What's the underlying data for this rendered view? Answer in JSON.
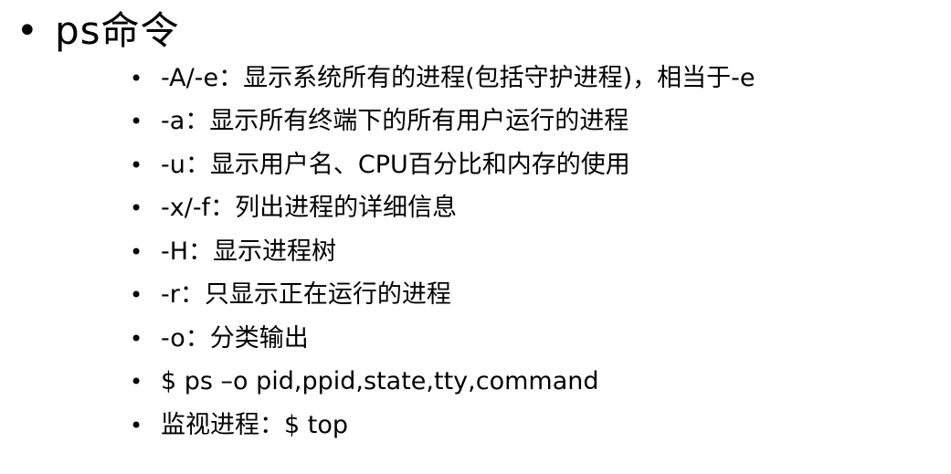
{
  "slide": {
    "title": "ps命令",
    "title_bullet": "•",
    "item_bullet": "•",
    "items": [
      {
        "text": "-A/-e：显示系统所有的进程(包括守护进程)，相当于-e"
      },
      {
        "text": "-a：显示所有终端下的所有用户运行的进程"
      },
      {
        "text": "-u：显示用户名、CPU百分比和内存的使用"
      },
      {
        "text": "-x/-f：列出进程的详细信息"
      },
      {
        "text": "-H：显示进程树"
      },
      {
        "text": "-r：只显示正在运行的进程"
      },
      {
        "text": "-o：分类输出"
      },
      {
        "text": "$ ps  –o  pid,ppid,state,tty,command"
      },
      {
        "text": "监视进程：$ top"
      }
    ]
  }
}
